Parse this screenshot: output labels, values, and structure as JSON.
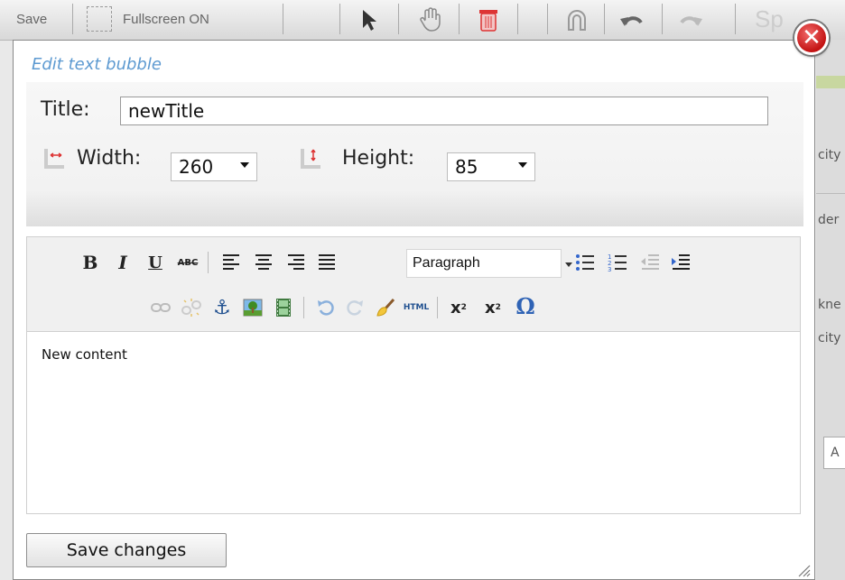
{
  "app_toolbar": {
    "save_label": "Save",
    "fullscreen_label": "Fullscreen ON",
    "tail_label": "Sp"
  },
  "background_fragments": [
    "city",
    "der",
    "kne",
    "city",
    "A"
  ],
  "dialog": {
    "title": "Edit text bubble",
    "close_icon": "close-icon"
  },
  "settings": {
    "title_label": "Title:",
    "title_value": "newTitle",
    "width_label": "Width:",
    "width_value": "260",
    "height_label": "Height:",
    "height_value": "85"
  },
  "editor": {
    "format_select": "Paragraph",
    "content": "New content",
    "html_label": "HTML"
  },
  "footer": {
    "save_changes_label": "Save changes"
  },
  "colors": {
    "title_blue": "#5d9ad1",
    "close_red": "#c31313"
  }
}
